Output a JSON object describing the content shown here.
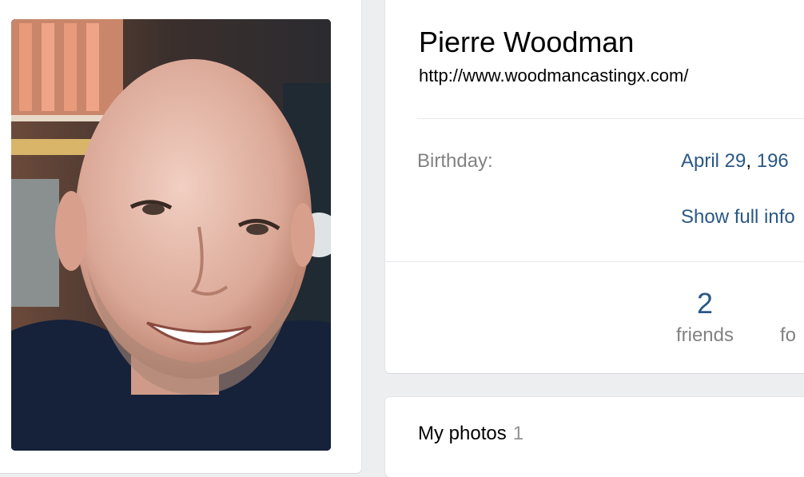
{
  "profile": {
    "name": "Pierre Woodman",
    "status": "http://www.woodmancastingx.com/",
    "birthday_label": "Birthday:",
    "birthday_date": "April 29",
    "birthday_sep": ",",
    "birthday_year": "196",
    "show_full_info": "Show full info"
  },
  "counters": [
    {
      "count": "2",
      "label": "friends"
    },
    {
      "count": "",
      "label": "fo"
    }
  ],
  "photos": {
    "title": "My photos",
    "count": "1"
  },
  "colors": {
    "link": "#2a5885",
    "muted": "#828282",
    "background": "#edeef0"
  }
}
